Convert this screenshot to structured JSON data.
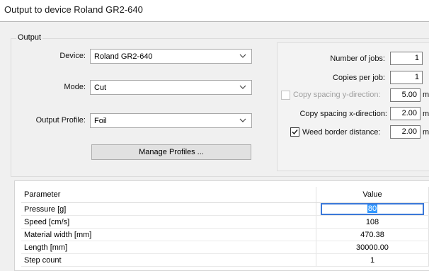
{
  "window": {
    "title": "Output to device Roland GR2-640"
  },
  "output_group": {
    "label": "Output",
    "device_label": "Device:",
    "device_value": "Roland GR2-640",
    "mode_label": "Mode:",
    "mode_value": "Cut",
    "profile_label": "Output Profile:",
    "profile_value": "Foil",
    "manage_button": "Manage Profiles ..."
  },
  "settings": {
    "jobs_label": "Number of jobs:",
    "jobs_value": "1",
    "copies_label": "Copies per job:",
    "copies_value": "1",
    "spacing_y_label": "Copy spacing y-direction:",
    "spacing_y_value": "5.00",
    "spacing_y_checked": false,
    "spacing_y_enabled": false,
    "spacing_y_unit": "mm",
    "spacing_x_label": "Copy spacing x-direction:",
    "spacing_x_value": "2.00",
    "spacing_x_unit": "mm",
    "weed_label": "Weed border distance:",
    "weed_value": "2.00",
    "weed_checked": true,
    "weed_unit": "mm"
  },
  "table": {
    "headers": [
      "Parameter",
      "Value"
    ],
    "rows": [
      {
        "parameter": "Pressure [g]",
        "value": "80",
        "editing": true
      },
      {
        "parameter": "Speed [cm/s]",
        "value": "108"
      },
      {
        "parameter": "Material width [mm]",
        "value": "470.38"
      },
      {
        "parameter": "Length [mm]",
        "value": "30000.00"
      },
      {
        "parameter": "Step count",
        "value": "1"
      }
    ]
  },
  "colors": {
    "dialog_bg": "#f0f0f0",
    "selection": "#3399ff",
    "focus_border": "#3b78d8"
  }
}
